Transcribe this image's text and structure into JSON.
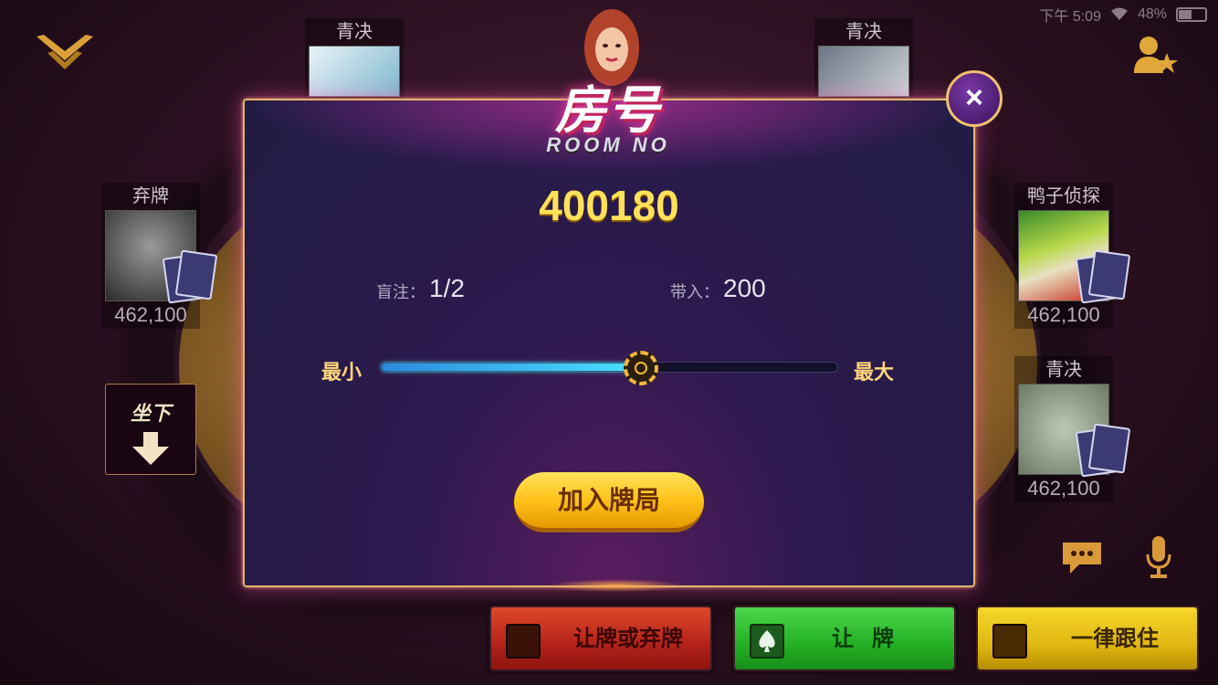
{
  "status_bar": {
    "time": "下午 5:09",
    "battery_percent": "48%"
  },
  "seats": {
    "top_left": {
      "name": "青决"
    },
    "top_right": {
      "name": "青决"
    },
    "left": {
      "name": "弃牌",
      "chips": "462,100"
    },
    "right_top": {
      "name": "鸭子侦探",
      "chips": "462,100"
    },
    "right_bottom": {
      "name": "青决",
      "chips": "462,100"
    }
  },
  "sit_down": {
    "label": "坐下"
  },
  "modal": {
    "title": "房号",
    "subtitle": "ROOM NO",
    "room_number": "400180",
    "blind_label": "盲注：",
    "blind_value": "1/2",
    "buyin_label": "带入：",
    "buyin_value": "200",
    "slider_min_label": "最小",
    "slider_max_label": "最大",
    "slider_level": 0.57,
    "join_label": "加入牌局",
    "close_label": "×"
  },
  "actions": {
    "fold_label": "让牌或弃牌",
    "check_label": "让牌",
    "call_label": "一律跟住"
  },
  "colors": {
    "accent_gold": "#ffe15a",
    "modal_border": "#e5b56e",
    "fold_red": "#c0301e",
    "check_green": "#2ab42a",
    "call_yellow": "#e8c018"
  }
}
